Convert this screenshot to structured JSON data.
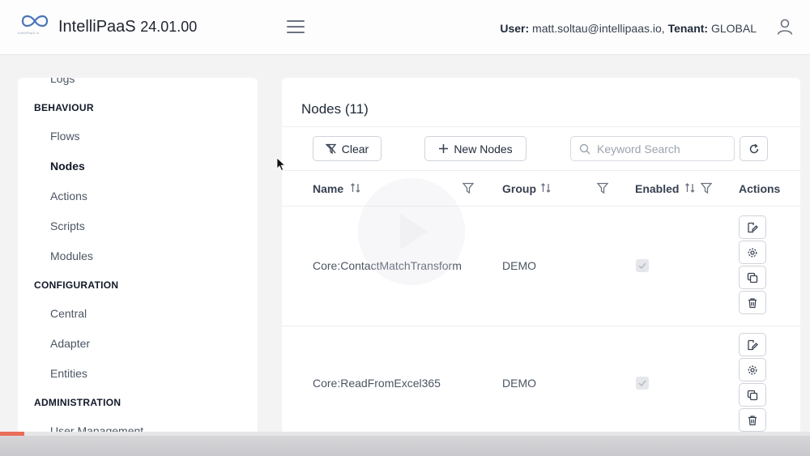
{
  "header": {
    "logo_text": "IntelliPaaS.io",
    "app_name": "IntelliPaaS",
    "version": "24.01.00",
    "user_label": "User:",
    "user_email": "matt.soltau@intellipaas.io,",
    "tenant_label": "Tenant:",
    "tenant_value": "GLOBAL"
  },
  "sidebar": {
    "top_item": "Logs",
    "sections": [
      {
        "title": "BEHAVIOUR",
        "items": [
          "Flows",
          "Nodes",
          "Actions",
          "Scripts",
          "Modules"
        ]
      },
      {
        "title": "CONFIGURATION",
        "items": [
          "Central",
          "Adapter",
          "Entities"
        ]
      },
      {
        "title": "ADMINISTRATION",
        "items": [
          "User Management"
        ]
      }
    ],
    "active_item": "Nodes"
  },
  "main": {
    "title": "Nodes (11)",
    "clear_label": "Clear",
    "new_label": "New Nodes",
    "search_placeholder": "Keyword Search",
    "columns": {
      "name": "Name",
      "group": "Group",
      "enabled": "Enabled",
      "actions": "Actions"
    },
    "rows": [
      {
        "name": "Core:ContactMatchTransform",
        "group": "DEMO",
        "enabled": true
      },
      {
        "name": "Core:ReadFromExcel365",
        "group": "DEMO",
        "enabled": true
      }
    ]
  },
  "colors": {
    "accent_progress": "#e96d57",
    "active_text": "#111827"
  }
}
